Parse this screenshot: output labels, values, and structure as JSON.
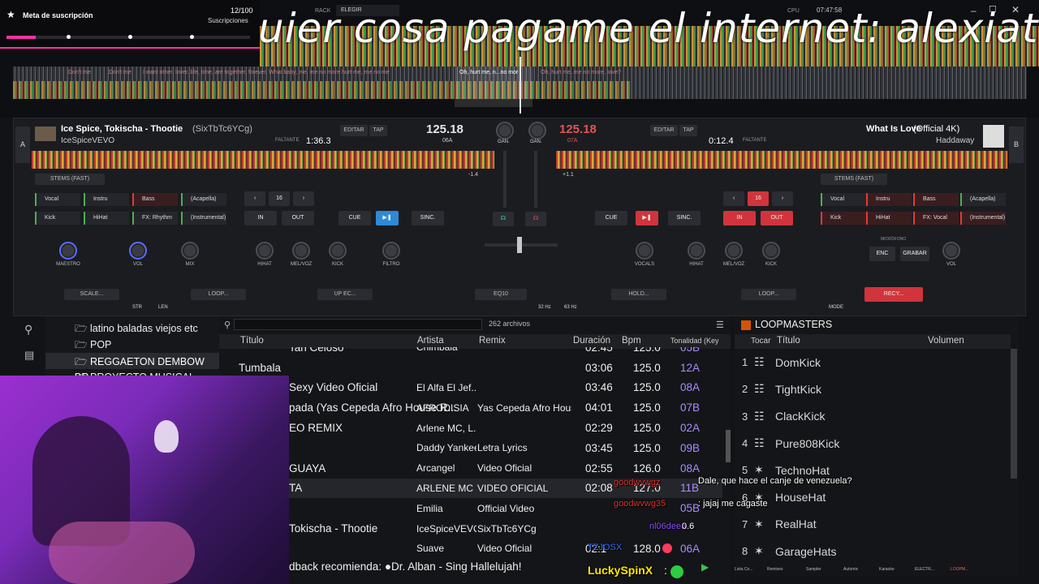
{
  "stream": {
    "overlay_text": "uier cosa pagame el internet: alexiat",
    "subscription_goal": {
      "title": "Meta de suscripción",
      "count": "12/100",
      "label": "Suscripciones",
      "progress_fraction": 0.12
    }
  },
  "top_bar": {
    "rack_label": "RACK",
    "rack_value": "ELEGIR",
    "cpu_label": "CPU",
    "clock": "07:47:58",
    "maestro_label": "MAESTRO"
  },
  "lyrics": [
    "Don't me",
    "Don't me",
    "I want other, lover, life, time, are together, forever, What baby, me, me no more  hurt me, me no me",
    "Oh, hurt me, n...no mor",
    "Oh, hurt me, me no more, love?"
  ],
  "deck_a": {
    "letter": "A",
    "title": "Ice Spice, Tokischa - Thootie",
    "title_extra": "(SixTbTc6YCg)",
    "artist": "IceSpiceVEVO",
    "bpm": "125.18",
    "key": "06A",
    "time": "1:36.3",
    "remaining": "FALTANTE",
    "editar": "EDITAR",
    "tap": "TAP",
    "stems": "STEMS (FAST)",
    "loop_size": "16",
    "pitch": "-1.4"
  },
  "deck_b": {
    "letter": "B",
    "title": "What Is Love",
    "title_extra": "(Official 4K)",
    "artist": "Haddaway",
    "bpm": "125.18",
    "key": "07A",
    "time": "0:12.4",
    "remaining": "FALTANTE",
    "editar": "EDITAR",
    "tap": "TAP",
    "stems": "STEMS (FAST)",
    "loop_size": "16",
    "pitch": "+1.1"
  },
  "pads_a": [
    "Vocal",
    "Instru",
    "Bass",
    "(Acapella)",
    "Kick",
    "HiHat",
    "FX: Rhythm",
    "(Instrumental)"
  ],
  "pads_b": [
    "Vocal",
    "Instru",
    "Bass",
    "(Acapella)",
    "Kick",
    "HiHat",
    "FX: Vocal",
    "(Instrumental)"
  ],
  "transport": {
    "cue": "CUE",
    "sync": "SINC.",
    "in": "IN",
    "out": "OUT"
  },
  "mixer": {
    "gain": "GAN.",
    "maestro": "MAESTRO",
    "vol": "VOL",
    "mix": "MIX",
    "microfono": "MICRÓFONO",
    "enc": "ENC",
    "grabar": "GRABAR"
  },
  "knobs_a": [
    "HIHAT",
    "MEL/VOZ",
    "KICK",
    "FILTRO"
  ],
  "knobs_b": [
    "VOCALS",
    "HIHAT",
    "MEL/VOZ",
    "KICK"
  ],
  "fx": {
    "a1": "SCALE...",
    "a2": "LOOP...",
    "a3": "UP EC...",
    "center": "EQ10",
    "b1": "HOLD...",
    "b2": "LOOP...",
    "b3": "RECY...",
    "str": "STR",
    "len": "LEN",
    "mode": "MODE",
    "hz32": "32 Hz",
    "hz63": "63 Hz"
  },
  "folders": [
    "latino baladas viejos etc",
    "POP",
    "REGGAETON DEMBOW BR",
    "PROYECTO MUSICAL"
  ],
  "browser": {
    "file_count": "262 archivos",
    "columns": [
      "Título",
      "Artista",
      "Remix",
      "Duración",
      "Bpm",
      "Tonalidad (Key"
    ],
    "rows": [
      {
        "title": "Tan Celoso",
        "artist": "Chimbala",
        "remix": "",
        "duration": "02:45",
        "bpm": "125.0",
        "key": "05B"
      },
      {
        "title": "Tumbala",
        "artist": "",
        "remix": "",
        "duration": "03:06",
        "bpm": "125.0",
        "key": "12A"
      },
      {
        "title": "Sexy  Video Oficial",
        "artist": "El Alfa El Jef...",
        "remix": "",
        "duration": "03:46",
        "bpm": "125.0",
        "key": "08A"
      },
      {
        "title": "pada (Yas Cepeda Afro House R...",
        "artist": "AFRODISIA",
        "remix": "Yas Cepeda Afro Hous...",
        "duration": "04:01",
        "bpm": "125.0",
        "key": "07B"
      },
      {
        "title": "EO REMIX",
        "artist": "Arlene MC, L...",
        "remix": "",
        "duration": "02:29",
        "bpm": "125.0",
        "key": "02A"
      },
      {
        "title": "",
        "artist": "Daddy Yankee",
        "remix": "Letra  Lyrics",
        "duration": "03:45",
        "bpm": "125.0",
        "key": "09B"
      },
      {
        "title": "GUAYA",
        "artist": "Arcangel",
        "remix": "Video Oficial",
        "duration": "02:55",
        "bpm": "126.0",
        "key": "08A"
      },
      {
        "title": "TA",
        "artist": "ARLENE MC",
        "remix": "VIDEO OFICIAL",
        "duration": "02:08",
        "bpm": "127.0",
        "key": "11B"
      },
      {
        "title": "",
        "artist": "Emilia",
        "remix": "Official Video",
        "duration": "",
        "bpm": "",
        "key": "05B"
      },
      {
        "title": "Tokischa - Thootie",
        "artist": "IceSpiceVEVO",
        "remix": "SixTbTc6YCg",
        "duration": "",
        "bpm": "",
        "key": ""
      },
      {
        "title": "",
        "artist": "Suave",
        "remix": "Video Oficial",
        "duration": "02:1",
        "bpm": "128.0",
        "key": "06A"
      }
    ],
    "recommendation": "dback recomienda: ●Dr. Alban - Sing Hallelujah!",
    "sideview": "sideview"
  },
  "loopmasters": {
    "title": "LOOPMASTERS",
    "columns": [
      "Tocar",
      "Título",
      "Volumen"
    ],
    "items": [
      "DomKick",
      "TightKick",
      "ClackKick",
      "Pure808Kick",
      "TechnoHat",
      "HouseHat",
      "RealHat",
      "GarageHats"
    ]
  },
  "bottom_tabs": [
    "Lista Co...",
    "Remixes",
    "Sampler",
    "Automix",
    "Karaoke",
    "ELECTR...",
    "LOOPM..."
  ],
  "chat": [
    {
      "user": "goodwvwgz",
      "text": "Dale, que hace el canje de venezuela?"
    },
    {
      "user": "goodwvwg35",
      "text": ": jajaj me cagaste"
    },
    {
      "user": "nl06deea",
      "text": "0.6"
    },
    {
      "user": "TZJOSX",
      "text": ""
    },
    {
      "user": "LuckySpinX",
      "text": ":"
    }
  ]
}
